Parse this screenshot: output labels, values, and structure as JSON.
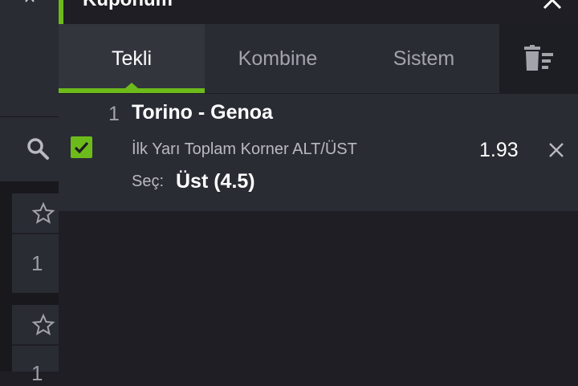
{
  "header": {
    "title": "Kuponum"
  },
  "tabs": [
    {
      "label": "Tekli",
      "active": true
    },
    {
      "label": "Kombine",
      "active": false
    },
    {
      "label": "Sistem",
      "active": false
    }
  ],
  "bet": {
    "index": "1",
    "match": "Torino - Genoa",
    "market": "İlk Yarı Toplam Korner ALT/ÜST",
    "odds": "1.93",
    "selection_label": "Seç:",
    "selection_value": "Üst (4.5)",
    "checked": true
  },
  "background": {
    "cards": [
      {
        "value": "1"
      },
      {
        "value": "1"
      }
    ]
  },
  "colors": {
    "accent": "#6dbb1a",
    "panel": "#2a2c34",
    "background": "#1e1e24"
  },
  "icons": [
    "chevron-up-icon",
    "close-icon",
    "search-icon",
    "trash-list-icon",
    "checkbox-checked-icon",
    "remove-icon",
    "star-icon"
  ]
}
